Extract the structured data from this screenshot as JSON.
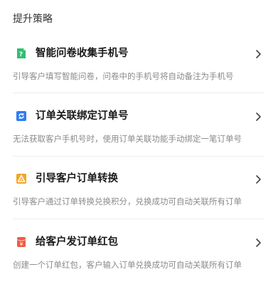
{
  "section_title": "提升策略",
  "items": [
    {
      "title": "智能问卷收集手机号",
      "desc": "引导客户填写智能问卷，问卷中的手机号将自动备注为手机号",
      "icon": "questionnaire-icon",
      "color": "#2fbf71"
    },
    {
      "title": "订单关联绑定订单号",
      "desc": "无法获取客户手机号时，使用订单关联功能手动绑定一笔订单号",
      "icon": "order-link-icon",
      "color": "#2f7df6"
    },
    {
      "title": "引导客户订单转换",
      "desc": "引导客户通过订单转换兑换积分，兑换成功可自动关联所有订单",
      "icon": "order-convert-icon",
      "color": "#f5a623"
    },
    {
      "title": "给客户发订单红包",
      "desc": "创建一个订单红包，客户输入订单兑换成功可自动关联所有订单",
      "icon": "red-packet-icon",
      "color": "#f05a4a"
    }
  ]
}
